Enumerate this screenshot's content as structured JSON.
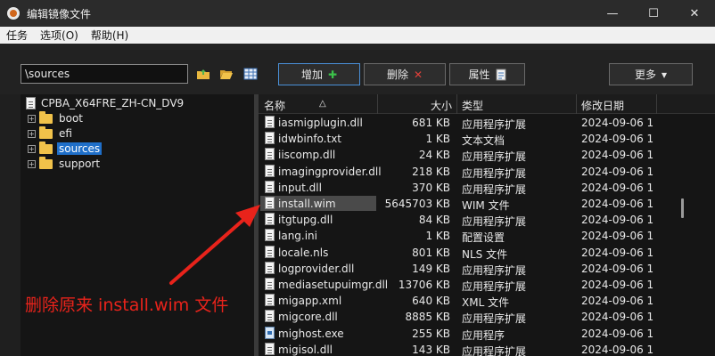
{
  "window": {
    "title": "编辑镜像文件",
    "minimize_icon": "—",
    "maximize_icon": "☐",
    "close_icon": "✕"
  },
  "menu": [
    "任务",
    "选项(O)",
    "帮助(H)"
  ],
  "toolbar": {
    "path_value": "\\sources",
    "add_label": "增加",
    "delete_label": "删除",
    "properties_label": "属性",
    "more_label": "更多",
    "more_arrow": "▾",
    "add_icon": "✚",
    "delete_icon": "✕",
    "colors": {
      "add_icon": "#3cc24a",
      "delete_icon": "#e0403a"
    }
  },
  "tree": {
    "root": "CPBA_X64FRE_ZH-CN_DV9",
    "expander_symbol": "+",
    "items": [
      {
        "label": "boot"
      },
      {
        "label": "efi"
      },
      {
        "label": "sources"
      },
      {
        "label": "support"
      }
    ]
  },
  "list": {
    "headers": {
      "name": "名称",
      "sort_arrow": "△",
      "size": "大小",
      "type": "类型",
      "modified": "修改日期"
    },
    "files": [
      {
        "name": "iasmigplugin.dll",
        "size": "681 KB",
        "type": "应用程序扩展",
        "date": "2024-09-06 1"
      },
      {
        "name": "idwbinfo.txt",
        "size": "1 KB",
        "type": "文本文档",
        "date": "2024-09-06 1"
      },
      {
        "name": "iiscomp.dll",
        "size": "24 KB",
        "type": "应用程序扩展",
        "date": "2024-09-06 1"
      },
      {
        "name": "imagingprovider.dll",
        "size": "218 KB",
        "type": "应用程序扩展",
        "date": "2024-09-06 1"
      },
      {
        "name": "input.dll",
        "size": "370 KB",
        "type": "应用程序扩展",
        "date": "2024-09-06 1"
      },
      {
        "name": "install.wim",
        "size": "5645703 KB",
        "type": "WIM 文件",
        "date": "2024-09-06 1"
      },
      {
        "name": "itgtupg.dll",
        "size": "84 KB",
        "type": "应用程序扩展",
        "date": "2024-09-06 1"
      },
      {
        "name": "lang.ini",
        "size": "1 KB",
        "type": "配置设置",
        "date": "2024-09-06 1"
      },
      {
        "name": "locale.nls",
        "size": "801 KB",
        "type": "NLS 文件",
        "date": "2024-09-06 1"
      },
      {
        "name": "logprovider.dll",
        "size": "149 KB",
        "type": "应用程序扩展",
        "date": "2024-09-06 1"
      },
      {
        "name": "mediasetupuimgr.dll",
        "size": "13706 KB",
        "type": "应用程序扩展",
        "date": "2024-09-06 1"
      },
      {
        "name": "migapp.xml",
        "size": "640 KB",
        "type": "XML 文件",
        "date": "2024-09-06 1"
      },
      {
        "name": "migcore.dll",
        "size": "8885 KB",
        "type": "应用程序扩展",
        "date": "2024-09-06 1"
      },
      {
        "name": "mighost.exe",
        "size": "255 KB",
        "type": "应用程序",
        "date": "2024-09-06 1"
      },
      {
        "name": "migisol.dll",
        "size": "143 KB",
        "type": "应用程序扩展",
        "date": "2024-09-06 1"
      }
    ]
  },
  "annotation": {
    "text": "删除原来 install.wim 文件",
    "color": "#e8231b"
  }
}
